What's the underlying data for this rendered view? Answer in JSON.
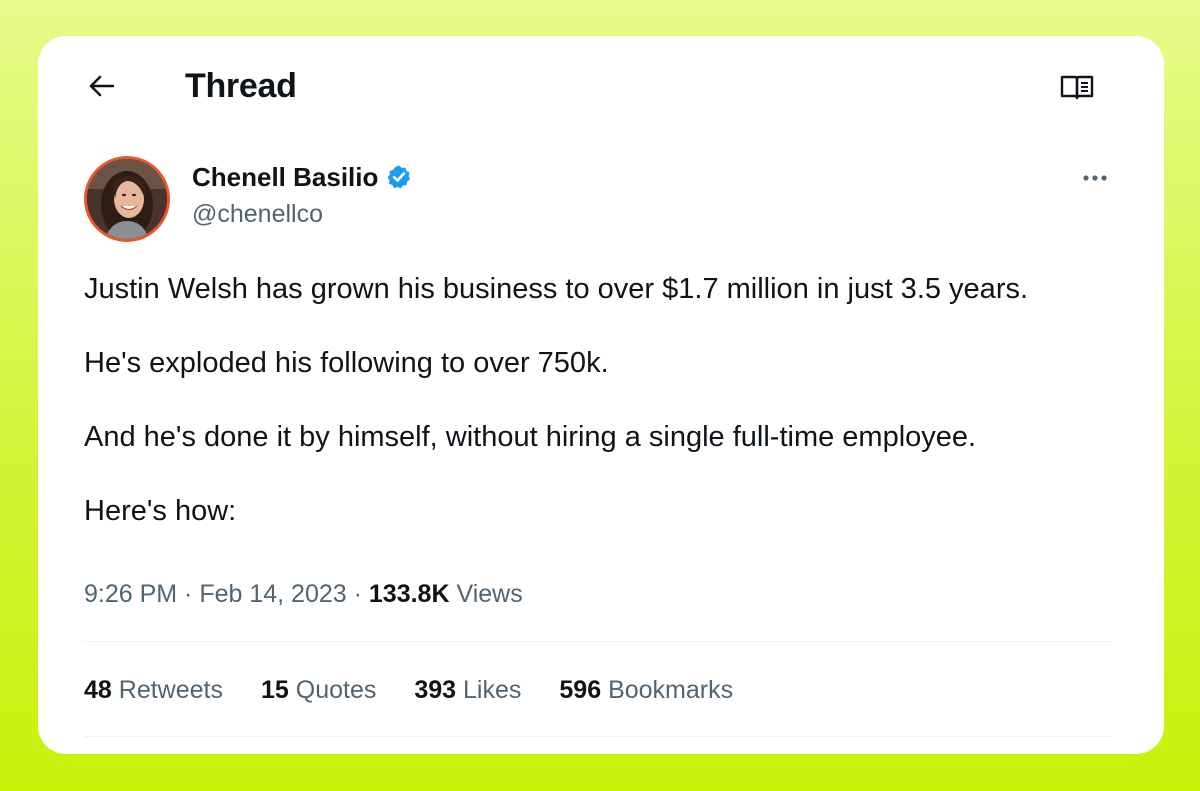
{
  "header": {
    "title": "Thread",
    "back_icon": "arrow-left-icon",
    "reader_icon": "reader-mode-icon"
  },
  "tweet": {
    "author": {
      "name": "Chenell Basilio",
      "handle": "@chenellco",
      "verified": true,
      "verified_color": "#1d9bf0",
      "avatar_ring_color": "#e8572d"
    },
    "text": [
      "Justin Welsh has grown his business to over $1.7 million in just 3.5 years.",
      "He's exploded his following to over 750k.",
      "And he's done it by himself, without hiring a single full-time employee.",
      "Here's how:"
    ],
    "meta": {
      "time": "9:26 PM",
      "separator": " · ",
      "date": "Feb 14, 2023",
      "views_count": "133.8K",
      "views_label": "Views"
    },
    "stats": [
      {
        "count": "48",
        "label": "Retweets"
      },
      {
        "count": "15",
        "label": "Quotes"
      },
      {
        "count": "393",
        "label": "Likes"
      },
      {
        "count": "596",
        "label": "Bookmarks"
      }
    ]
  },
  "colors": {
    "text_primary": "#0f1419",
    "text_secondary": "#536471",
    "background_gradient_top": "#e6fb8a",
    "background_gradient_bottom": "#c8f20a"
  }
}
